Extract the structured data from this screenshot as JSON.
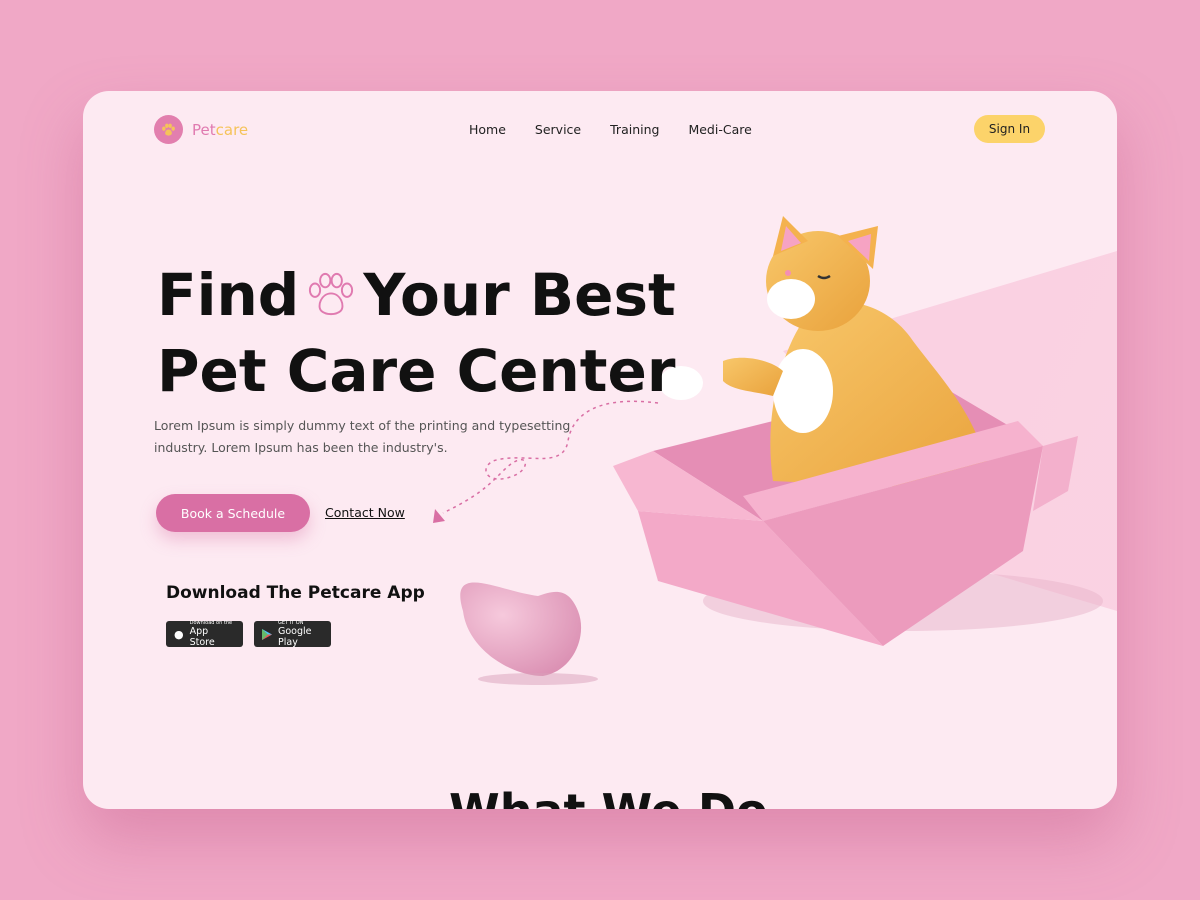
{
  "brand": {
    "name_part1": "Pet",
    "name_part2": "care"
  },
  "nav": {
    "items": [
      "Home",
      "Service",
      "Training",
      "Medi-Care"
    ]
  },
  "signin_label": "Sign In",
  "hero": {
    "title_word1": "Find",
    "title_rest1": "Your Best",
    "title_line2": "Pet Care Center",
    "description_line1": "Lorem Ipsum is simply dummy text of the printing and typesetting",
    "description_line2": "industry. Lorem Ipsum has been the industry's.",
    "book_label": "Book a Schedule",
    "contact_label": "Contact Now"
  },
  "download": {
    "title": "Download The Petcare App",
    "app_store_small": "Download on the",
    "app_store_big": "App Store",
    "google_play_small": "GET IT ON",
    "google_play_big": "Google Play"
  },
  "next_section_title": "What We Do",
  "colors": {
    "accent_pink": "#d96fa4",
    "accent_yellow": "#fcd36a",
    "background": "#f0a8c6",
    "card": "#fdeaf2"
  }
}
